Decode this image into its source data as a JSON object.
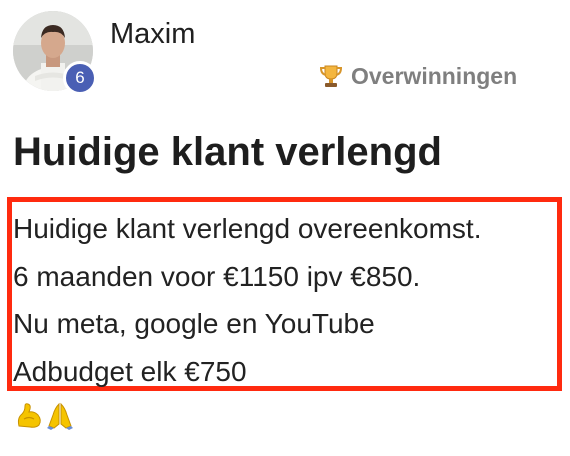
{
  "post": {
    "author": {
      "name": "Maxim",
      "level": "6",
      "avatar_icon": "avatar-photo-icon"
    },
    "category": {
      "icon": "trophy-icon",
      "label": "Overwinningen"
    },
    "title": "Huidige klant verlengd",
    "body_lines": [
      "Huidige klant verlengd overeenkomst.",
      "6 maanden voor €1150 ipv €850.",
      "Nu meta, google en YouTube",
      "Adbudget elk €750"
    ],
    "emojis": [
      "flexed-biceps-icon",
      "folded-hands-icon"
    ],
    "highlight_color": "#ff2a0f",
    "badge_color": "#4a5fb4"
  }
}
